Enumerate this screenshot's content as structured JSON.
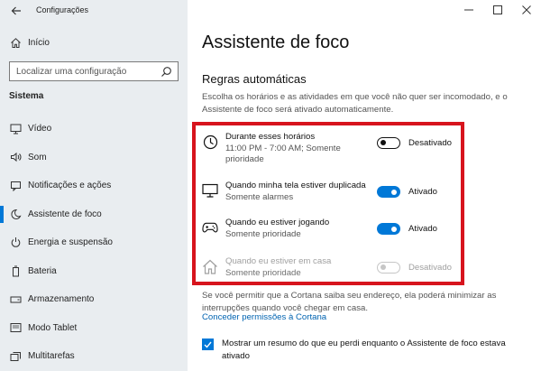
{
  "window": {
    "title": "Configurações"
  },
  "sidebar": {
    "home_label": "Início",
    "search_placeholder": "Localizar uma configuração",
    "section": "Sistema",
    "items": [
      {
        "label": "Vídeo",
        "icon": "monitor-icon"
      },
      {
        "label": "Som",
        "icon": "speaker-icon"
      },
      {
        "label": "Notificações e ações",
        "icon": "notification-icon"
      },
      {
        "label": "Assistente de foco",
        "icon": "moon-icon",
        "active": true
      },
      {
        "label": "Energia e suspensão",
        "icon": "power-icon"
      },
      {
        "label": "Bateria",
        "icon": "battery-icon"
      },
      {
        "label": "Armazenamento",
        "icon": "storage-icon"
      },
      {
        "label": "Modo Tablet",
        "icon": "tablet-icon"
      },
      {
        "label": "Multitarefas",
        "icon": "multitask-icon"
      }
    ]
  },
  "main": {
    "title": "Assistente de foco",
    "subtitle": "Regras automáticas",
    "description": "Escolha os horários e as atividades em que você não quer ser incomodado, e o Assistente de foco será ativado automaticamente.",
    "rules": [
      {
        "title": "Durante esses horários",
        "sub": "11:00 PM - 7:00 AM; Somente prioridade",
        "state": "Desativado",
        "on": false,
        "disabled": false,
        "icon": "clock-icon"
      },
      {
        "title": "Quando minha tela estiver duplicada",
        "sub": "Somente alarmes",
        "state": "Ativado",
        "on": true,
        "disabled": false,
        "icon": "monitor-icon"
      },
      {
        "title": "Quando eu estiver jogando",
        "sub": "Somente prioridade",
        "state": "Ativado",
        "on": true,
        "disabled": false,
        "icon": "gamepad-icon"
      },
      {
        "title": "Quando eu estiver em casa",
        "sub": "Somente prioridade",
        "state": "Desativado",
        "on": false,
        "disabled": true,
        "icon": "home-icon"
      }
    ],
    "cortana_note": "Se você permitir que a Cortana saiba seu endereço, ela poderá minimizar as interrupções quando você chegar em casa.",
    "cortana_link": "Conceder permissões à Cortana",
    "summary_checkbox": {
      "label": "Mostrar um resumo do que eu perdi enquanto o Assistente de foco estava ativado",
      "checked": true
    }
  },
  "colors": {
    "accent": "#0078d7",
    "highlight_box": "#d7141d",
    "sidebar_bg": "#e9edf0"
  }
}
